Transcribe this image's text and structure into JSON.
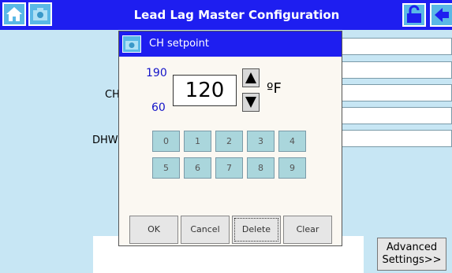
{
  "header": {
    "title": "Lead Lag Master Configuration"
  },
  "background": {
    "labels": {
      "ch": "CH",
      "dhw": "DHW"
    },
    "advanced_label_line1": "Advanced",
    "advanced_label_line2": "Settings>>"
  },
  "dialog": {
    "title": "CH setpoint",
    "max": "190",
    "min": "60",
    "value": "120",
    "unit": "ºF",
    "keys": [
      "0",
      "1",
      "2",
      "3",
      "4",
      "5",
      "6",
      "7",
      "8",
      "9"
    ],
    "buttons": {
      "ok": "OK",
      "cancel": "Cancel",
      "delete": "Delete",
      "clear": "Clear"
    }
  }
}
